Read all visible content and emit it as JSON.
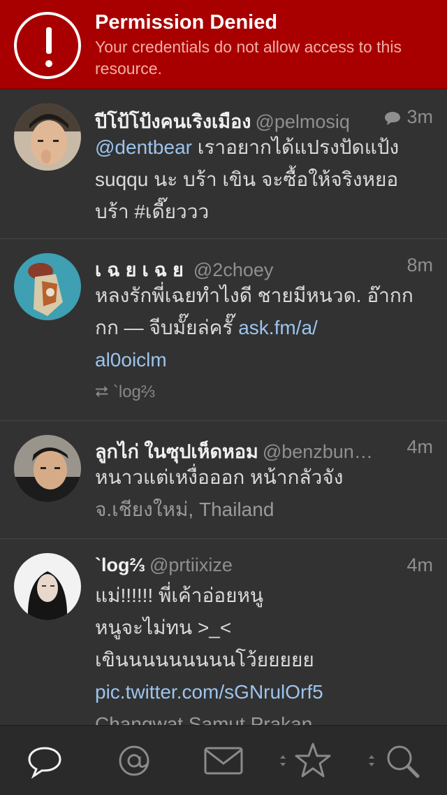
{
  "banner": {
    "title": "Permission Denied",
    "message": "Your credentials do not allow access to this resource."
  },
  "tweets": [
    {
      "name": "ปีโป้โป้งคนเริงเมือง",
      "handle": "@pelmosiq",
      "time": "3m",
      "mention": "@dentbear",
      "text1": " เราอยากได้แปรงปัดแป้ง",
      "text2": "suqqu นะ บร้า เขิน จะซื้อให้จริงหยอ",
      "text3": "บร้า #เดี๊ยววว"
    },
    {
      "name": "เฉยเฉย",
      "handle": "@2choey",
      "time": "8m",
      "text1": "หลงรักพี่เฉยทำไงดี ชายมีหนวด. อ๊ากก",
      "text2": "กก — จีบมั๊ยล่ครั๊ ",
      "link1": "ask.fm/a/",
      "link2": "al0oiclm",
      "retweet_icon": "⮂",
      "retweeter": "`log⅔"
    },
    {
      "name": "ลูกไก่ ในซุปเห็ดหอม",
      "handle": "@benzbun…",
      "time": "4m",
      "text1": "หนาวแต่เหงื่อออก หน้ากลัวจัง",
      "location": "จ.เชียงใหม่, Thailand"
    },
    {
      "name": "`log⅔",
      "handle": "@prtiixize",
      "time": "4m",
      "text1": "แม่!!!!!! พี่เค้าอ่อยหนู",
      "text2": "หนูจะไม่ทน >_<",
      "text3": "เขินนนนนนนนนโว้ยยยยย",
      "link": "pic.twitter.com/sGNrulOrf5",
      "location": "Changwat Samut Prakan"
    }
  ],
  "tabbar": {
    "tabs": [
      "chat-bubble-icon",
      "at-icon",
      "mail-icon",
      "star-icon",
      "search-icon"
    ]
  }
}
